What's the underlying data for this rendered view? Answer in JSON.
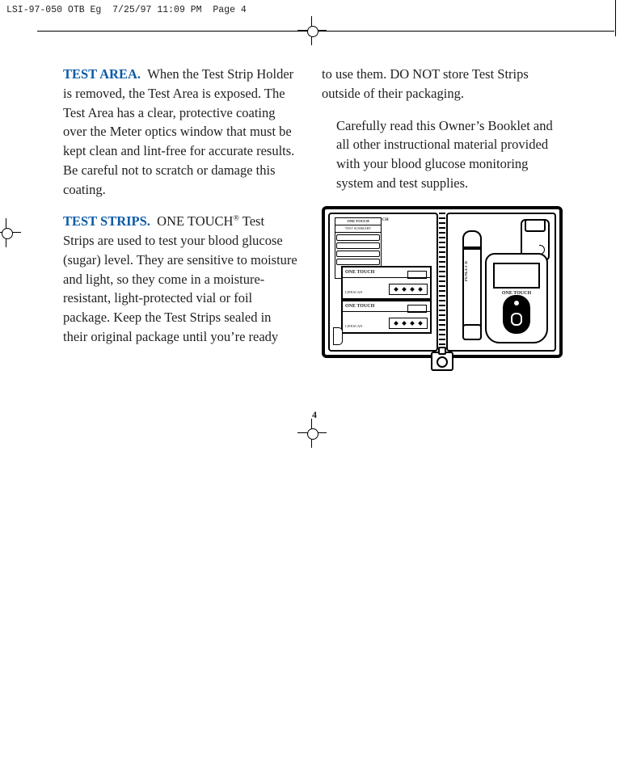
{
  "slug": {
    "job": "LSI-97-050 OTB Eg",
    "timestamp": "7/25/97 11:09 PM",
    "page_label": "Page 4"
  },
  "page_number": "4",
  "left_column": {
    "para1": {
      "lede": "TEST AREA.",
      "body": "When the Test Strip Holder is removed, the Test Area is exposed. The Test Area has a clear, protective coating over the Meter optics window that must be kept clean and lint-free for accurate results. Be careful not to scratch or damage this coating."
    },
    "para2": {
      "lede": "TEST STRIPS.",
      "body_pre": "ONE TOUCH",
      "body_post": " Test Strips are used to test your blood glucose (sugar) level. They are sensitive to moisture and light, so they come in a moisture-resistant, light-protected vial or foil package. Keep the Test Strips sealed in their original package until you’re ready"
    }
  },
  "right_column": {
    "para1": "to use them. DO NOT store Test Strips outside of their packaging.",
    "para2": "Carefully read this Owner’s Booklet and all other instructional material provided with your blood glucose monitoring system and test supplies."
  },
  "illustration": {
    "logbook_brand": "ONE TOUCH",
    "logbook_title": "TEST SUMMARY",
    "stripbox_brand": "ONE TOUCH",
    "stripbox_sub": "LIFESCAN",
    "pen_label": "PENLET II",
    "meter_brand": "ONE TOUCH"
  }
}
